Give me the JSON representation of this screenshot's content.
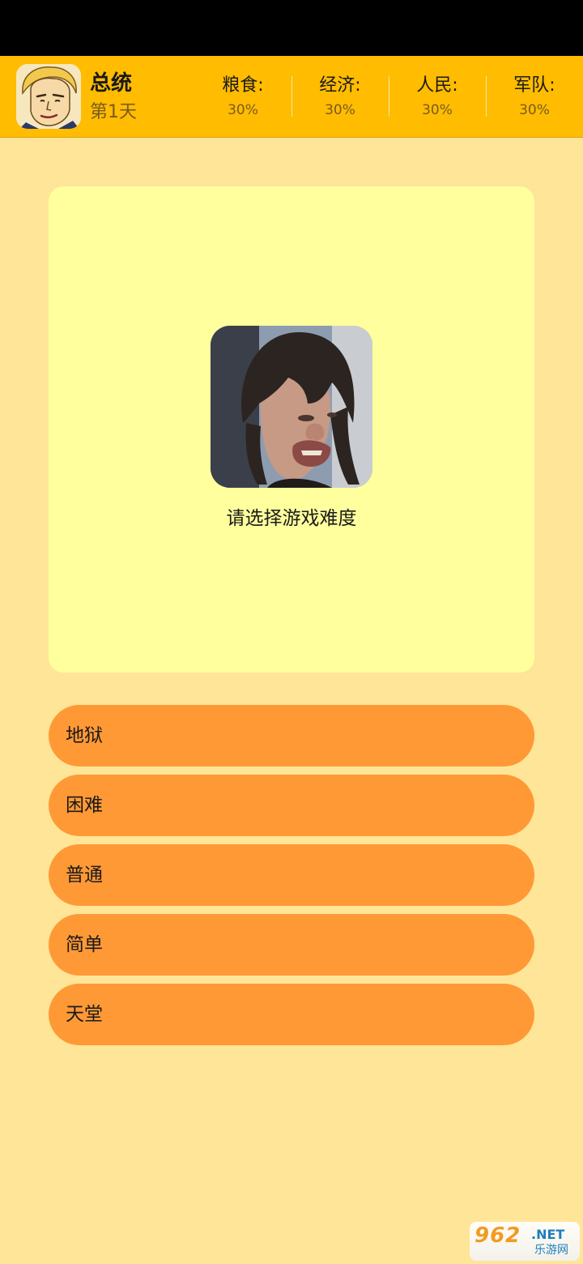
{
  "header": {
    "player_name": "总统",
    "day": "第1天",
    "stats": [
      {
        "label": "粮食:",
        "value": "30%"
      },
      {
        "label": "经济:",
        "value": "30%"
      },
      {
        "label": "人民:",
        "value": "30%"
      },
      {
        "label": "军队:",
        "value": "30%"
      }
    ]
  },
  "card": {
    "prompt": "请选择游戏难度"
  },
  "options": [
    {
      "label": "地狱"
    },
    {
      "label": "困难"
    },
    {
      "label": "普通"
    },
    {
      "label": "简单"
    },
    {
      "label": "天堂"
    }
  ],
  "watermark": {
    "logo": "962",
    "suffix": ".NET",
    "subtitle": "乐游网"
  },
  "colors": {
    "status_bar": "#000000",
    "top_bar": "#FFBC00",
    "background": "#FFE597",
    "card": "#FFFF9D",
    "option_button": "#FF9936"
  }
}
